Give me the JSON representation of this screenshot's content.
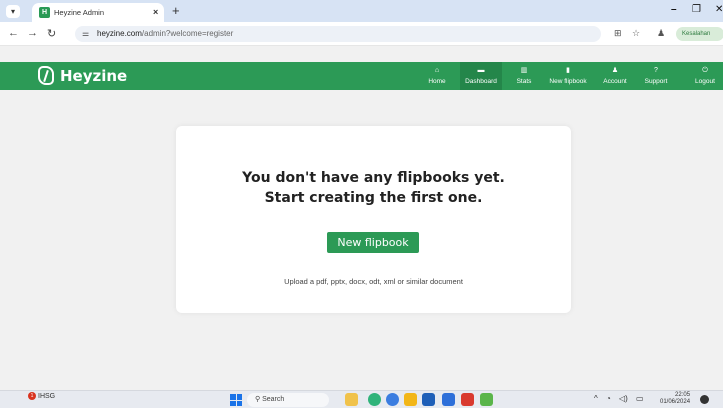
{
  "browser": {
    "tab_title": "Heyzine Admin",
    "favicon_letter": "H",
    "url_host": "heyzine.com",
    "url_path": "/admin?welcome=register",
    "profile_label": "Kesalahan",
    "new_tab": "+",
    "close_tab": "×",
    "minimize": "–",
    "restore": "❐",
    "close_window": "✕"
  },
  "app": {
    "brand": "Heyzine",
    "nav": [
      {
        "label": "Home",
        "icon": "⌂"
      },
      {
        "label": "Dashboard",
        "icon": "▬"
      },
      {
        "label": "Stats",
        "icon": "▥"
      },
      {
        "label": "New flipbook",
        "icon": "▮"
      },
      {
        "label": "Account",
        "icon": "♟"
      },
      {
        "label": "Support",
        "icon": "?"
      },
      {
        "label": "Logout",
        "icon": "⏻"
      }
    ],
    "active_nav": "Dashboard"
  },
  "main": {
    "empty_title_line1": "You don't have any flipbooks yet.",
    "empty_title_line2": "Start creating the first one.",
    "new_button": "New flipbook",
    "hint": "Upload a pdf, pptx, docx, odt, xml or similar document"
  },
  "taskbar": {
    "weather_label": "IHSG",
    "search_placeholder": "Search",
    "time": "22:05",
    "date": "01/06/2024"
  },
  "colors": {
    "brand_green": "#2c9a56",
    "active_nav": "#24864a",
    "tabstrip": "#d7e3f4",
    "page_bg": "#f1f1f1"
  }
}
